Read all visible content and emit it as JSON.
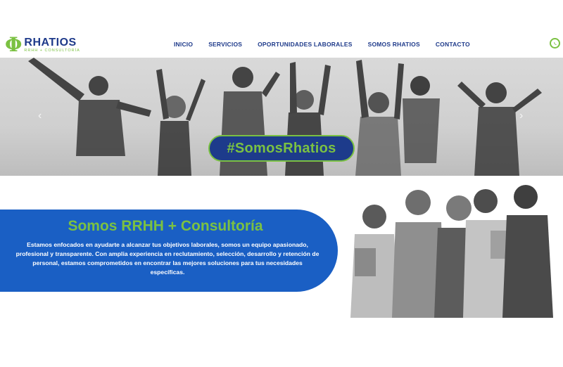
{
  "header": {
    "logo_symbol": "Φ",
    "logo_name": "RHATIOS",
    "logo_tagline": "RRHH + CONSULTORÍA",
    "nav": [
      {
        "label": "INICIO"
      },
      {
        "label": "SERVICIOS"
      },
      {
        "label": "OPORTUNIDADES LABORALES"
      },
      {
        "label": "SOMOS RHATIOS"
      },
      {
        "label": "CONTACTO"
      }
    ],
    "whatsapp_icon": "whatsapp-icon"
  },
  "hero": {
    "hashtag": "#SomosRhatios",
    "prev_arrow": "‹",
    "next_arrow": "›"
  },
  "about": {
    "title": "Somos RRHH + Consultoría",
    "text": "Estamos enfocados en ayudarte a alcanzar tus objetivos laborales, somos un equipo apasionado, profesional y transparente. Con amplia experiencia en reclutamiento, selección, desarrollo y retención de personal, estamos comprometidos en encontrar las mejores soluciones para tus necesidades específicas."
  },
  "colors": {
    "brand_blue": "#1e3a8a",
    "brand_green": "#7bc142",
    "section_blue": "#1a5fc4"
  }
}
